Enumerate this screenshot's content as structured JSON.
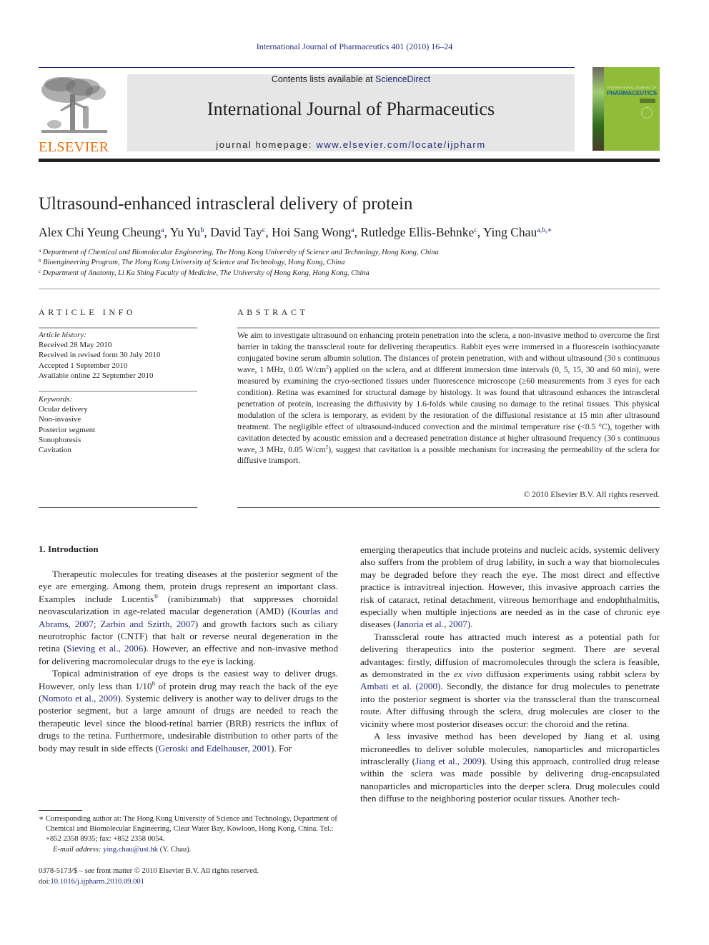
{
  "running_head": "International Journal of Pharmaceutics 401 (2010) 16–24",
  "publisher": {
    "name": "ELSEVIER",
    "logo_icon": "elsevier-tree-icon"
  },
  "masthead": {
    "contents_prefix": "Contents lists available at ",
    "contents_link": "ScienceDirect",
    "journal_title": "International Journal of Pharmaceutics",
    "homepage_prefix": "journal homepage: ",
    "homepage_url": "www.elsevier.com/locate/ijpharm"
  },
  "cover": {
    "line1": "INTERNATIONAL JOURNAL OF",
    "line2": "PHARMACEUTICS"
  },
  "colors": {
    "link": "#1f2a7a",
    "elsevier_orange": "#e8720c",
    "masthead_bg": "#e6e6e6",
    "cover_green": "#8fbd3a"
  },
  "article": {
    "title": "Ultrasound-enhanced intrascleral delivery of protein",
    "authors": [
      {
        "name": "Alex Chi Yeung Cheung",
        "sup": "a"
      },
      {
        "name": "Yu Yu",
        "sup": "b"
      },
      {
        "name": "David Tay",
        "sup": "c"
      },
      {
        "name": "Hoi Sang Wong",
        "sup": "a"
      },
      {
        "name": "Rutledge Ellis-Behnke",
        "sup": "c"
      },
      {
        "name": "Ying Chau",
        "sup": "a,b,∗"
      }
    ],
    "affiliations": [
      {
        "sup": "a",
        "text": "Department of Chemical and Biomolecular Engineering, The Hong Kong University of Science and Technology, Hong Kong, China"
      },
      {
        "sup": "b",
        "text": "Bioengineering Program, The Hong Kong University of Science and Technology, Hong Kong, China"
      },
      {
        "sup": "c",
        "text": "Department of Anatomy, Li Ka Shing Faculty of Medicine, The University of Hong Kong, Hong Kong, China"
      }
    ]
  },
  "article_info": {
    "heading": "ARTICLE INFO",
    "history_label": "Article history:",
    "history": [
      "Received 28 May 2010",
      "Received in revised form 30 July 2010",
      "Accepted 1 September 2010",
      "Available online 22 September 2010"
    ],
    "keywords_label": "Keywords:",
    "keywords": [
      "Ocular delivery",
      "Non-invasive",
      "Posterior segment",
      "Sonophoresis",
      "Cavitation"
    ]
  },
  "abstract": {
    "heading": "ABSTRACT",
    "part1": "We aim to investigate ultrasound on enhancing protein penetration into the sclera, a non-invasive method to overcome the first barrier in taking the transscleral route for delivering therapeutics. Rabbit eyes were immersed in a fluorescein isothiocyanate conjugated bovine serum albumin solution. The distances of protein penetration, with and without ultrasound (30 s continuous wave, 1 MHz, 0.05 W/cm",
    "sup1": "2",
    "part2": ") applied on the sclera, and at different immersion time intervals (0, 5, 15, 30 and 60 min), were measured by examining the cryo-sectioned tissues under fluorescence microscope (≥60 measurements from 3 eyes for each condition). Retina was examined for structural damage by histology. It was found that ultrasound enhances the intrascleral penetration of protein, increasing the diffusivity by 1.6-folds while causing no damage to the retinal tissues. This physical modulation of the sclera is temporary, as evident by the restoration of the diffusional resistance at 15 min after ultrasound treatment. The negligible effect of ultrasound-induced convection and the minimal temperature rise (<0.5 °C), together with cavitation detected by acoustic emission and a decreased penetration distance at higher ultrasound frequency (30 s continuous wave, 3 MHz, 0.05 W/cm",
    "sup2": "2",
    "part3": "), suggest that cavitation is a possible mechanism for increasing the permeability of the sclera for diffusive transport.",
    "copyright": "© 2010 Elsevier B.V. All rights reserved."
  },
  "introduction": {
    "heading": "1.  Introduction",
    "left_p1": [
      {
        "t": "Therapeutic molecules for treating diseases at the posterior segment of the eye are emerging. Among them, protein drugs represent an important class. Examples include Lucentis"
      },
      {
        "sup": "®"
      },
      {
        "t": " (ranibizumab) that suppresses choroidal neovascularization in age-related macular degeneration (AMD) ("
      },
      {
        "link": "Kourlas and Abrams, 2007; Zarbin and Szirth, 2007"
      },
      {
        "t": ") and growth factors such as ciliary neurotrophic factor (CNTF) that halt or reverse neural degeneration in the retina ("
      },
      {
        "link": "Sieving et al., 2006"
      },
      {
        "t": "). However, an effective and non-invasive method for delivering macromolecular drugs to the eye is lacking."
      }
    ],
    "left_p2": [
      {
        "t": "Topical administration of eye drops is the easiest way to deliver drugs. However, only less than 1/10"
      },
      {
        "sup": "8"
      },
      {
        "t": " of protein drug may reach the back of the eye ("
      },
      {
        "link": "Nomoto et al., 2009"
      },
      {
        "t": "). Systemic delivery is another way to deliver drugs to the posterior segment, but a large amount of drugs are needed to reach the therapeutic level since the blood-retinal barrier (BRB) restricts the influx of drugs to the retina. Furthermore, undesirable distribution to other parts of the body may result in side effects ("
      },
      {
        "link": "Geroski and Edelhauser, 2001"
      },
      {
        "t": "). For"
      }
    ],
    "right_p0": [
      {
        "t": "emerging therapeutics that include proteins and nucleic acids, systemic delivery also suffers from the problem of drug lability, in such a way that biomolecules may be degraded before they reach the eye. The most direct and effective practice is intravitreal injection. However, this invasive approach carries the risk of cataract, retinal detachment, vitreous hemorrhage and endophthalmitis, especially when multiple injections are needed as in the case of chronic eye diseases ("
      },
      {
        "link": "Janoria et al., 2007"
      },
      {
        "t": ")."
      }
    ],
    "right_p1": [
      {
        "t": "Transscleral route has attracted much interest as a potential path for delivering therapeutics into the posterior segment. There are several advantages: firstly, diffusion of macromolecules through the sclera is feasible, as demonstrated in the "
      },
      {
        "em": "ex vivo"
      },
      {
        "t": " diffusion experiments using rabbit sclera by "
      },
      {
        "link": "Ambati et al. (2000)"
      },
      {
        "t": ". Secondly, the distance for drug molecules to penetrate into the posterior segment is shorter via the transscleral than the transcorneal route. After diffusing through the sclera, drug molecules are closer to the vicinity where most posterior diseases occur: the choroid and the retina."
      }
    ],
    "right_p2": [
      {
        "t": "A less invasive method has been developed by Jiang et al. using microneedles to deliver soluble molecules, nanoparticles and microparticles intrasclerally ("
      },
      {
        "link": "Jiang et al., 2009"
      },
      {
        "t": "). Using this approach, controlled drug release within the sclera was made possible by delivering drug-encapsulated nanoparticles and microparticles into the deeper sclera. Drug molecules could then diffuse to the neighboring posterior ocular tissues. Another tech-"
      }
    ]
  },
  "footnote": {
    "star_text": "∗ Corresponding author at: The Hong Kong University of Science and Technology, Department of Chemical and Biomolecular Engineering, Clear Water Bay, Kowloon, Hong Kong, China. Tel.: +852 2358 8935; fax: +852 2358 0054.",
    "email_label": "E-mail address:",
    "email": "ying.chau@ust.hk",
    "email_suffix": " (Y. Chau)."
  },
  "front_matter": {
    "issn_line": "0378-5173/$ – see front matter © 2010 Elsevier B.V. All rights reserved.",
    "doi_prefix": "doi:",
    "doi": "10.1016/j.ijpharm.2010.09.001"
  }
}
